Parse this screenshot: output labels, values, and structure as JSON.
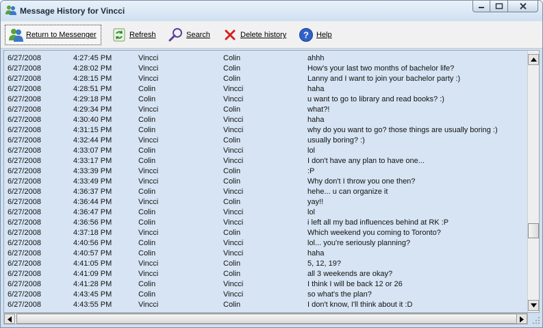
{
  "window": {
    "title": "Message History for Vincci"
  },
  "toolbar": {
    "return_label": "Return to Messenger",
    "refresh_label": "Refresh",
    "search_label": "Search",
    "delete_label": "Delete history",
    "help_label": "Help"
  },
  "icons": {
    "title": "messenger-buddies-icon",
    "return": "messenger-buddies-icon",
    "refresh": "refresh-icon",
    "search": "magnifier-icon",
    "delete": "red-x-icon",
    "help": "help-question-icon"
  },
  "colors": {
    "list_background": "#d6e4f3",
    "title_background": "#cfe0f1",
    "toolbar_background": "#f1f1f1"
  },
  "messages": [
    {
      "date": "6/27/2008",
      "time": "4:27:45 PM",
      "from": "Vincci",
      "to": "Colin",
      "text": "ahhh"
    },
    {
      "date": "6/27/2008",
      "time": "4:28:02 PM",
      "from": "Vincci",
      "to": "Colin",
      "text": "How's your last two months of bachelor life?"
    },
    {
      "date": "6/27/2008",
      "time": "4:28:15 PM",
      "from": "Vincci",
      "to": "Colin",
      "text": "Lanny and I want to join your bachelor party :)"
    },
    {
      "date": "6/27/2008",
      "time": "4:28:51 PM",
      "from": "Colin",
      "to": "Vincci",
      "text": "haha"
    },
    {
      "date": "6/27/2008",
      "time": "4:29:18 PM",
      "from": "Colin",
      "to": "Vincci",
      "text": "u want to go to library and read books? :)"
    },
    {
      "date": "6/27/2008",
      "time": "4:29:34 PM",
      "from": "Vincci",
      "to": "Colin",
      "text": "what?!"
    },
    {
      "date": "6/27/2008",
      "time": "4:30:40 PM",
      "from": "Colin",
      "to": "Vincci",
      "text": "haha"
    },
    {
      "date": "6/27/2008",
      "time": "4:31:15 PM",
      "from": "Colin",
      "to": "Vincci",
      "text": "why do you want to go? those things are usually boring :)"
    },
    {
      "date": "6/27/2008",
      "time": "4:32:44 PM",
      "from": "Vincci",
      "to": "Colin",
      "text": "usually boring? :)"
    },
    {
      "date": "6/27/2008",
      "time": "4:33:07 PM",
      "from": "Colin",
      "to": "Vincci",
      "text": "lol"
    },
    {
      "date": "6/27/2008",
      "time": "4:33:17 PM",
      "from": "Colin",
      "to": "Vincci",
      "text": "I don't have any plan to have one..."
    },
    {
      "date": "6/27/2008",
      "time": "4:33:39 PM",
      "from": "Vincci",
      "to": "Colin",
      "text": ":P"
    },
    {
      "date": "6/27/2008",
      "time": "4:33:49 PM",
      "from": "Vincci",
      "to": "Colin",
      "text": "Why don't I throw you one then?"
    },
    {
      "date": "6/27/2008",
      "time": "4:36:37 PM",
      "from": "Colin",
      "to": "Vincci",
      "text": "hehe... u can organize it"
    },
    {
      "date": "6/27/2008",
      "time": "4:36:44 PM",
      "from": "Vincci",
      "to": "Colin",
      "text": "yay!!"
    },
    {
      "date": "6/27/2008",
      "time": "4:36:47 PM",
      "from": "Colin",
      "to": "Vincci",
      "text": "lol"
    },
    {
      "date": "6/27/2008",
      "time": "4:36:56 PM",
      "from": "Colin",
      "to": "Vincci",
      "text": "i left all my bad influences behind at RK :P"
    },
    {
      "date": "6/27/2008",
      "time": "4:37:18 PM",
      "from": "Vincci",
      "to": "Colin",
      "text": "Which weekend you coming to Toronto?"
    },
    {
      "date": "6/27/2008",
      "time": "4:40:56 PM",
      "from": "Colin",
      "to": "Vincci",
      "text": "lol... you're seriously planning?"
    },
    {
      "date": "6/27/2008",
      "time": "4:40:57 PM",
      "from": "Colin",
      "to": "Vincci",
      "text": "haha"
    },
    {
      "date": "6/27/2008",
      "time": "4:41:05 PM",
      "from": "Vincci",
      "to": "Colin",
      "text": "5, 12, 19?"
    },
    {
      "date": "6/27/2008",
      "time": "4:41:09 PM",
      "from": "Vincci",
      "to": "Colin",
      "text": "all 3 weekends are okay?"
    },
    {
      "date": "6/27/2008",
      "time": "4:41:28 PM",
      "from": "Colin",
      "to": "Vincci",
      "text": "I think I will be back 12 or 26"
    },
    {
      "date": "6/27/2008",
      "time": "4:43:45 PM",
      "from": "Colin",
      "to": "Vincci",
      "text": "so what's the plan?"
    },
    {
      "date": "6/27/2008",
      "time": "4:43:55 PM",
      "from": "Vincci",
      "to": "Colin",
      "text": "I don't know, I'll think about it :D"
    }
  ]
}
